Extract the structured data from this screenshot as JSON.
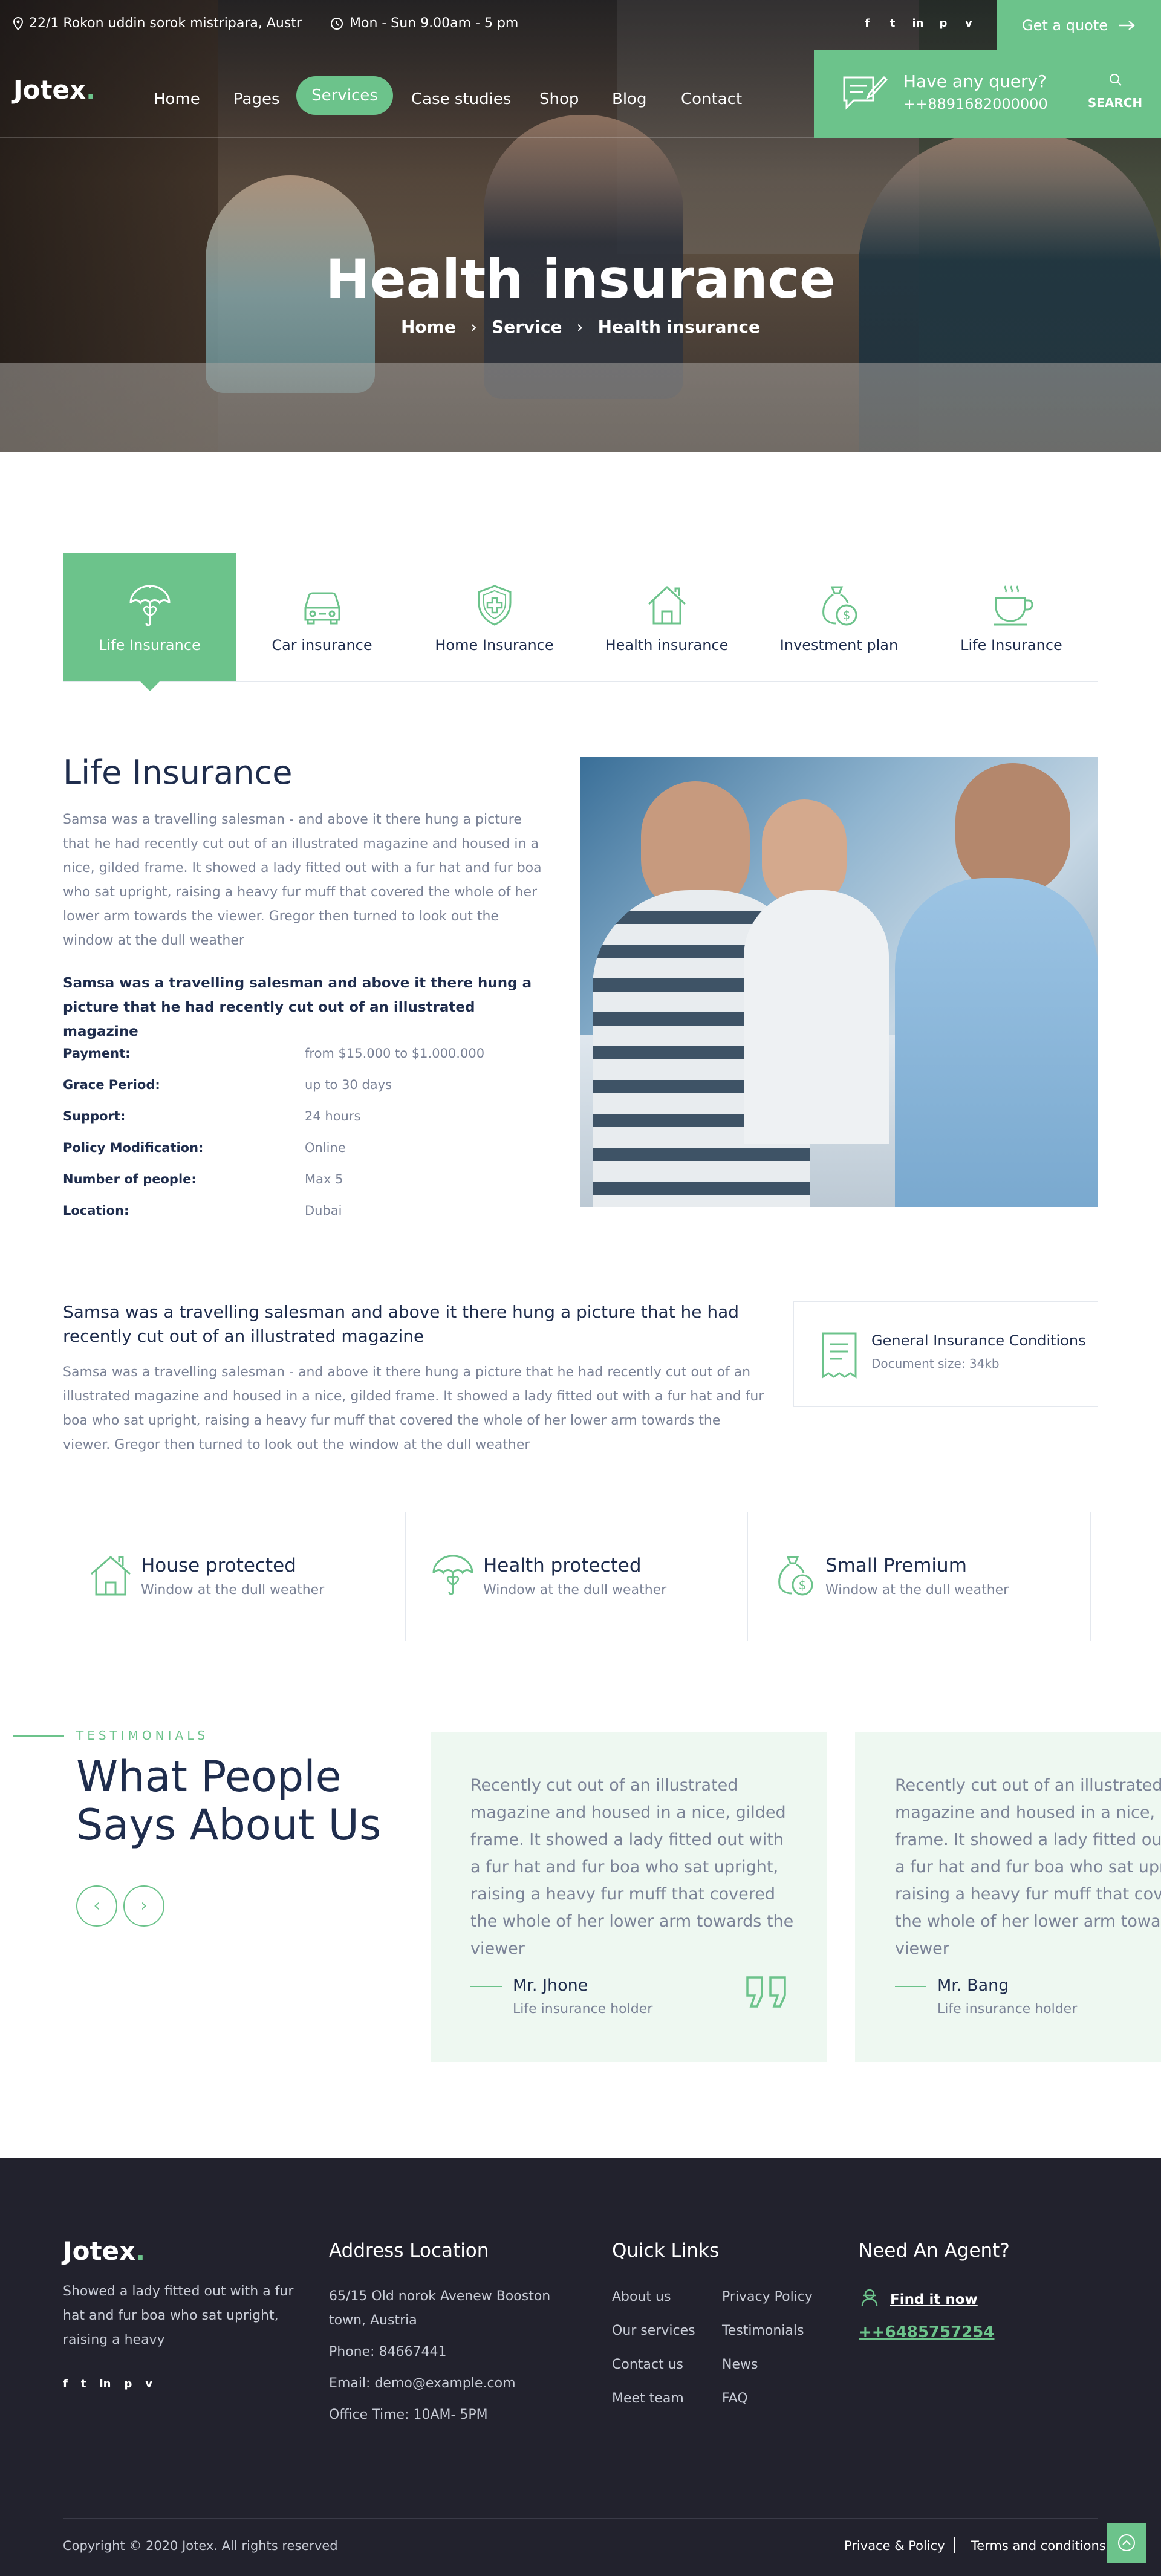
{
  "topbar": {
    "address": "22/1 Rokon uddin sorok mistripara, Austr",
    "hours": "Mon - Sun 9.00am - 5 pm",
    "social_icons": [
      "facebook-icon",
      "twitter-icon",
      "linkedin-icon",
      "pinterest-icon",
      "vimeo-icon"
    ],
    "social_glyphs": [
      "f",
      "t",
      "in",
      "p",
      "v"
    ],
    "quote_label": "Get a quote"
  },
  "nav": {
    "logo": "Jotex",
    "logo_dot": ".",
    "items": [
      "Home",
      "Pages",
      "Services",
      "Case studies",
      "Shop",
      "Blog",
      "Contact"
    ],
    "active": "Services",
    "query_title": "Have any query?",
    "query_phone": "++8891682000000",
    "search_label": "SEARCH"
  },
  "hero": {
    "title": "Health insurance",
    "breadcrumb": [
      "Home",
      "Service",
      "Health insurance"
    ]
  },
  "tabs": [
    {
      "label": "Life Insurance",
      "icon": "umbrella-heart-icon",
      "active": true
    },
    {
      "label": "Car insurance",
      "icon": "car-icon",
      "active": false
    },
    {
      "label": "Home Insurance",
      "icon": "shield-plus-icon",
      "active": false
    },
    {
      "label": "Health insurance",
      "icon": "house-heart-icon",
      "active": false
    },
    {
      "label": "Investment plan",
      "icon": "money-bag-icon",
      "active": false
    },
    {
      "label": "Life Insurance",
      "icon": "coffee-cup-icon",
      "active": false
    }
  ],
  "life": {
    "title": "Life Insurance",
    "paragraph": "Samsa was a travelling salesman - and above it there hung a picture that he had recently cut out of an illustrated magazine and housed in a nice, gilded frame. It showed a lady fitted out with a fur hat and fur boa who sat upright, raising a heavy fur muff that covered the whole of her lower arm towards the viewer. Gregor then turned to look out the window at the dull weather",
    "strong": "Samsa was a travelling salesman and above it there hung a picture that he had recently cut out of an illustrated magazine",
    "details": [
      {
        "k": "Payment:",
        "v": "from $15.000 to $1.000.000"
      },
      {
        "k": "Grace Period:",
        "v": "up to 30 days"
      },
      {
        "k": "Support:",
        "v": "24 hours"
      },
      {
        "k": "Policy Modification:",
        "v": "Online"
      },
      {
        "k": "Number of people:",
        "v": "Max 5"
      },
      {
        "k": "Location:",
        "v": "Dubai"
      }
    ]
  },
  "second": {
    "heading": "Samsa was a travelling salesman and above it there hung a picture that he had recently cut out of an illustrated magazine",
    "paragraph": "Samsa was a travelling salesman - and above it there hung a picture that he had recently cut out of an illustrated magazine and housed in a nice, gilded frame. It showed a lady fitted out with a fur hat and fur boa who sat upright, raising a heavy fur muff that covered the whole of her lower arm towards the viewer. Gregor then turned to look out the window at the dull weather",
    "doc_title": "General Insurance Conditions",
    "doc_size": "Document size: 34kb"
  },
  "features": [
    {
      "title": "House protected",
      "sub": "Window at the dull weather",
      "icon": "house-icon"
    },
    {
      "title": "Health protected",
      "sub": "Window at the dull weather",
      "icon": "umbrella-heart-icon"
    },
    {
      "title": "Small Premium",
      "sub": "Window at the dull weather",
      "icon": "money-bag-icon"
    }
  ],
  "testimonials": {
    "label": "TESTIMONIALS",
    "title": "What People Says About Us",
    "cards": [
      {
        "text": "Recently cut out of an illustrated magazine and housed in a nice, gilded frame. It showed a lady fitted out with a fur hat and fur boa who sat upright, raising a heavy fur muff that covered the whole of her lower arm towards the viewer",
        "name": "Mr. Jhone",
        "role": "Life insurance holder"
      },
      {
        "text": "Recently cut out of an illustrated magazine and housed in a nice, gilded frame. It showed a lady fitted out with a fur hat and fur boa who sat upright, raising a heavy fur muff that covered the whole of her lower arm towards the viewer",
        "name": "Mr. Bang",
        "role": "Life insurance holder"
      }
    ]
  },
  "footer": {
    "logo": "Jotex",
    "logo_dot": ".",
    "about": "Showed a lady fitted out with a fur hat and fur boa who sat upright, raising a heavy",
    "address_head": "Address Location",
    "address": "65/15 Old norok Avenew Booston town, Austria",
    "phone": "Phone: 84667441",
    "email": "Email: demo@example.com",
    "office": "Office Time: 10AM- 5PM",
    "links_head": "Quick Links",
    "links_col1": [
      "About us",
      "Our services",
      "Contact us",
      "Meet team"
    ],
    "links_col2": [
      "Privacy Policy",
      "Testimonials",
      "News",
      "FAQ"
    ],
    "agent_head": "Need An Agent?",
    "find_now": "Find it now",
    "agent_phone": "++6485757254",
    "copyright": "Copyright © 2020 Jotex. All rights reserved",
    "privacy": "Privace & Policy",
    "terms": "Terms and conditions"
  },
  "colors": {
    "accent": "#6cc38b",
    "navy": "#1f2d4d",
    "muted": "#7b8397",
    "footer_bg": "#22222d"
  }
}
